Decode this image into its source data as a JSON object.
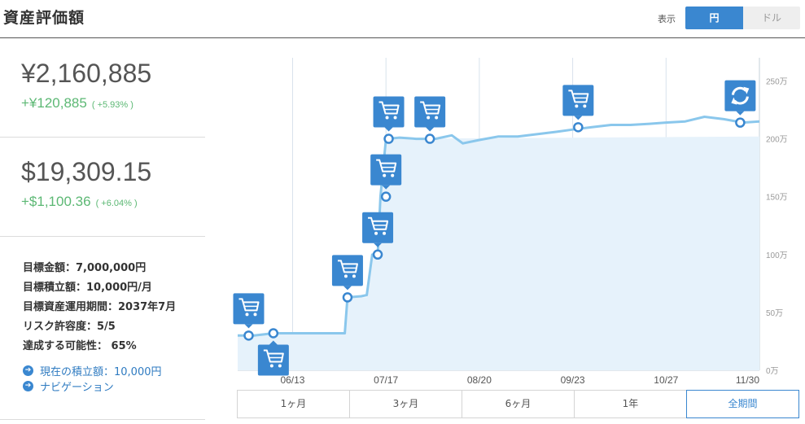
{
  "header": {
    "title": "資産評価額",
    "display_label": "表示",
    "currency_toggle": {
      "yen": "円",
      "dollar": "ドル",
      "selected": "円"
    }
  },
  "summary": {
    "jpy": {
      "amount": "¥2,160,885",
      "gain": "+¥120,885",
      "gain_pct": "( +5.93% )"
    },
    "usd": {
      "amount": "$19,309.15",
      "gain": "+$1,100.36",
      "gain_pct": "( +6.04% )"
    }
  },
  "goals": [
    "目標金額：7,000,000円",
    "目標積立額：10,000円/月",
    "目標資産運用期間：2037年7月",
    "リスク許容度：5/5",
    "達成する可能性： 65%"
  ],
  "links": [
    {
      "label": "現在の積立額：10,000円"
    },
    {
      "label": "ナビゲーション"
    }
  ],
  "colors": {
    "accent": "#3a87d0",
    "positive": "#5cb874",
    "line": "#8ac7ec",
    "area": "#e6f2fb"
  },
  "ranges": [
    {
      "label": "1ヶ月",
      "active": false
    },
    {
      "label": "3ヶ月",
      "active": false
    },
    {
      "label": "6ヶ月",
      "active": false
    },
    {
      "label": "1年",
      "active": false
    },
    {
      "label": "全期間",
      "active": true
    }
  ],
  "chart_data": {
    "type": "line",
    "y_unit": "万",
    "ylim": [
      0,
      270
    ],
    "xlim": [
      "2016-05-24",
      "2016-11-30"
    ],
    "y_ticks": [
      {
        "value": 0,
        "label": "0万"
      },
      {
        "value": 50,
        "label": "50万"
      },
      {
        "value": 100,
        "label": "100万"
      },
      {
        "value": 150,
        "label": "150万"
      },
      {
        "value": 200,
        "label": "200万"
      },
      {
        "value": 250,
        "label": "250万"
      }
    ],
    "x_ticks": [
      {
        "date": "2016-06-13",
        "label": "06/13"
      },
      {
        "date": "2016-07-17",
        "label": "07/17"
      },
      {
        "date": "2016-08-20",
        "label": "08/20"
      },
      {
        "date": "2016-09-23",
        "label": "09/23"
      },
      {
        "date": "2016-10-27",
        "label": "10/27"
      },
      {
        "date": "2016-11-30",
        "label": "11/30"
      }
    ],
    "grid": "vertical",
    "series": [
      {
        "kind": "market-value",
        "style": "line",
        "points": [
          [
            "2016-05-24",
            30
          ],
          [
            "2016-05-30",
            30
          ],
          [
            "2016-06-06",
            32
          ],
          [
            "2016-06-12",
            32
          ],
          [
            "2016-06-20",
            32
          ],
          [
            "2016-06-28",
            32
          ],
          [
            "2016-07-02",
            32
          ],
          [
            "2016-07-03",
            63
          ],
          [
            "2016-07-08",
            64
          ],
          [
            "2016-07-10",
            65
          ],
          [
            "2016-07-12",
            100
          ],
          [
            "2016-07-14",
            101
          ],
          [
            "2016-07-15",
            150
          ],
          [
            "2016-07-17",
            200
          ],
          [
            "2016-07-22",
            201
          ],
          [
            "2016-07-28",
            200
          ],
          [
            "2016-08-04",
            200
          ],
          [
            "2016-08-10",
            203
          ],
          [
            "2016-08-14",
            196
          ],
          [
            "2016-08-20",
            199
          ],
          [
            "2016-08-27",
            202
          ],
          [
            "2016-09-03",
            202
          ],
          [
            "2016-09-10",
            204
          ],
          [
            "2016-09-17",
            206
          ],
          [
            "2016-09-23",
            208
          ],
          [
            "2016-09-30",
            210
          ],
          [
            "2016-10-07",
            212
          ],
          [
            "2016-10-14",
            212
          ],
          [
            "2016-10-21",
            213
          ],
          [
            "2016-10-27",
            214
          ],
          [
            "2016-11-03",
            215
          ],
          [
            "2016-11-10",
            219
          ],
          [
            "2016-11-17",
            217
          ],
          [
            "2016-11-24",
            214
          ],
          [
            "2016-11-30",
            215
          ]
        ]
      },
      {
        "kind": "invested-principal",
        "style": "area",
        "points": [
          [
            "2016-05-24",
            30
          ],
          [
            "2016-05-30",
            30
          ],
          [
            "2016-06-06",
            32
          ],
          [
            "2016-07-02",
            32
          ],
          [
            "2016-07-03",
            63
          ],
          [
            "2016-07-10",
            63
          ],
          [
            "2016-07-12",
            100
          ],
          [
            "2016-07-14",
            100
          ],
          [
            "2016-07-15",
            150
          ],
          [
            "2016-07-17",
            200
          ],
          [
            "2016-11-30",
            202
          ]
        ]
      }
    ],
    "markers": [
      {
        "date": "2016-05-28",
        "value": 30,
        "icon": "cart-icon",
        "position": "above"
      },
      {
        "date": "2016-06-06",
        "value": 32,
        "icon": "cart-icon",
        "position": "below"
      },
      {
        "date": "2016-07-03",
        "value": 63,
        "icon": "cart-icon",
        "position": "above"
      },
      {
        "date": "2016-07-14",
        "value": 100,
        "icon": "cart-icon",
        "position": "above"
      },
      {
        "date": "2016-07-17",
        "value": 150,
        "icon": "cart-icon",
        "position": "above"
      },
      {
        "date": "2016-07-18",
        "value": 200,
        "icon": "cart-icon",
        "position": "above"
      },
      {
        "date": "2016-08-02",
        "value": 200,
        "icon": "cart-icon",
        "position": "above"
      },
      {
        "date": "2016-09-25",
        "value": 210,
        "icon": "cart-icon",
        "position": "above"
      },
      {
        "date": "2016-11-23",
        "value": 214,
        "icon": "rebalance-icon",
        "position": "above"
      }
    ]
  }
}
